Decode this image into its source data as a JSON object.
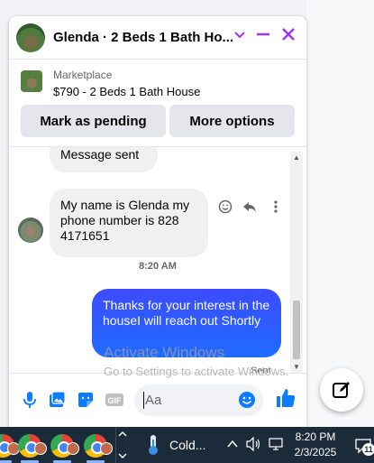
{
  "header": {
    "title": "Glenda · 2 Beds 1 Bath Ho...",
    "accent_color": "#a033ff"
  },
  "listing": {
    "label": "Marketplace",
    "price_title": "$790 - 2 Beds 1 Bath House",
    "mark_pending_label": "Mark as pending",
    "more_options_label": "More options"
  },
  "messages": {
    "partial_message": "Message sent",
    "incoming_message": "My name is Glenda my phone number is 828 4171651",
    "timestamp": "8:20 AM",
    "outgoing_message": "Thanks for your interest in the houseI will reach out Shortly",
    "sent_status": "Sent"
  },
  "composer": {
    "placeholder": "Aa"
  },
  "watermark": {
    "line1": "Activate Windows",
    "line2": "Go to Settings to activate Windows."
  },
  "taskbar": {
    "weather_label": "Cold...",
    "time": "8:20 PM",
    "date": "2/3/2025",
    "notification_count": "11"
  }
}
